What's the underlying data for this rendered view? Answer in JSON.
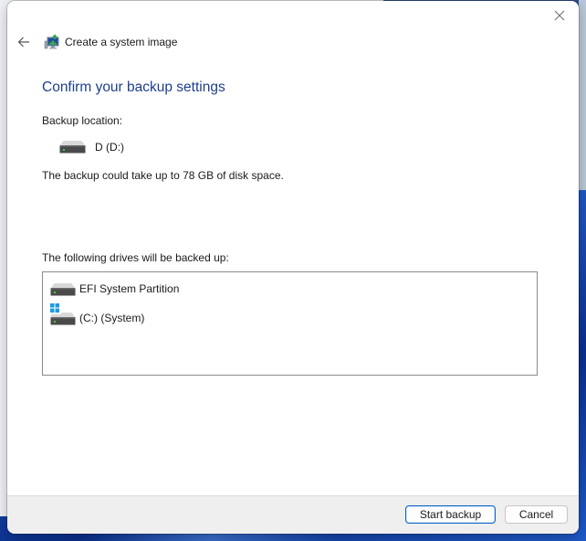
{
  "window": {
    "title": "Create a system image",
    "close_icon": "close-icon",
    "back_icon": "arrow-left-icon",
    "app_icon": "system-image-backup-icon"
  },
  "main": {
    "heading": "Confirm your backup settings",
    "backup_location_label": "Backup location:",
    "backup_location": {
      "icon": "hard-drive-icon",
      "name": "D (D:)"
    },
    "space_note": "The backup could take up to 78 GB of disk space.",
    "drives_label": "The following drives will be backed up:",
    "drives": [
      {
        "name": "EFI System Partition",
        "icon": "hard-drive-icon",
        "windows_badge": false
      },
      {
        "name": "(C:) (System)",
        "icon": "hard-drive-icon",
        "windows_badge": true
      }
    ]
  },
  "footer": {
    "start_label": "Start backup",
    "cancel_label": "Cancel"
  },
  "colors": {
    "heading": "#1e3f8f",
    "primary_button_border": "#0a64c8",
    "windows_logo": "#1f9ae0",
    "drive_led": "#38d04a"
  }
}
